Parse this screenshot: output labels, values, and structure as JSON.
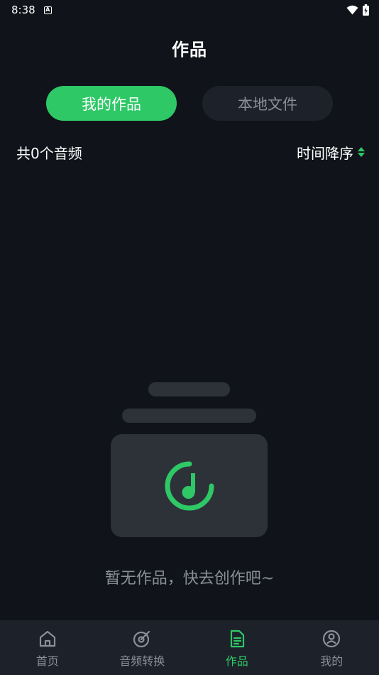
{
  "status": {
    "time": "8:38",
    "notif_letter": "A"
  },
  "header": {
    "title": "作品"
  },
  "tabs": [
    {
      "label": "我的作品",
      "active": true
    },
    {
      "label": "本地文件",
      "active": false
    }
  ],
  "summary": {
    "count_text": "共0个音频",
    "sort_label": "时间降序"
  },
  "empty_state": {
    "message": "暂无作品，快去创作吧~",
    "icon": "music-note-icon"
  },
  "nav": [
    {
      "label": "首页",
      "icon": "home-icon",
      "active": false
    },
    {
      "label": "音频转换",
      "icon": "disc-convert-icon",
      "active": false
    },
    {
      "label": "作品",
      "icon": "document-icon",
      "active": true
    },
    {
      "label": "我的",
      "icon": "profile-icon",
      "active": false
    }
  ],
  "colors": {
    "accent": "#2ec866",
    "background": "#10141a",
    "surface": "#1d222a"
  }
}
